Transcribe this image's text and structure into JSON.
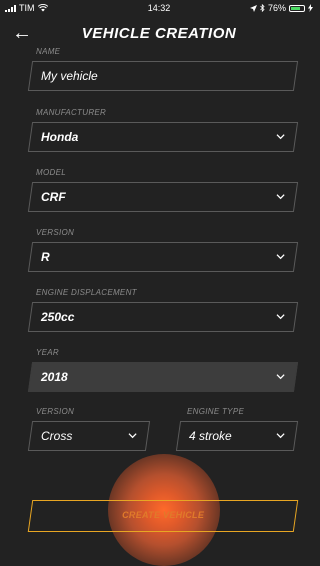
{
  "status_bar": {
    "carrier": "TIM",
    "time": "14:32",
    "battery": "76%",
    "battery_level": 0.76,
    "icons": [
      "signal-icon",
      "wifi-icon",
      "location-icon",
      "bluetooth-icon",
      "battery-icon",
      "charging-icon"
    ]
  },
  "header": {
    "title": "VEHICLE CREATION",
    "back_icon": "back-arrow-icon"
  },
  "form": {
    "name": {
      "label": "NAME",
      "value": "My vehicle"
    },
    "manufacturer": {
      "label": "MANUFACTURER",
      "value": "Honda"
    },
    "model": {
      "label": "MODEL",
      "value": "CRF"
    },
    "version": {
      "label": "VERSION",
      "value": "R"
    },
    "engine_displacement": {
      "label": "ENGINE DISPLACEMENT",
      "value": "250cc"
    },
    "year": {
      "label": "YEAR",
      "value": "2018"
    },
    "version2": {
      "label": "VERSION",
      "value": "Cross"
    },
    "engine_type": {
      "label": "ENGINE TYPE",
      "value": "4 stroke"
    }
  },
  "actions": {
    "create_label": "CREATE VEHICLE"
  },
  "colors": {
    "background": "#222222",
    "field_border": "#5a5a5a",
    "field_filled": "#3d3d3d",
    "label": "#8c8c8c",
    "accent_border": "#e8a623",
    "accent_text": "#e07a2a"
  }
}
